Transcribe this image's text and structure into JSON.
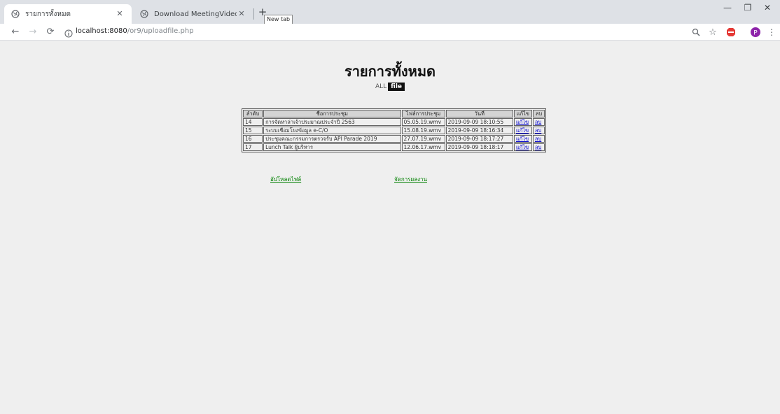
{
  "browser": {
    "tabs": [
      {
        "title": "รายการทั้งหมด",
        "active": true
      },
      {
        "title": "Download MeetingVideo",
        "active": false
      }
    ],
    "new_tab_tooltip": "New tab",
    "address": {
      "host": "localhost:8080",
      "path": "/or9/uploadfile.php"
    },
    "profile_initial": "P"
  },
  "page": {
    "title": "รายการทั้งหมด",
    "filter": {
      "all": "ALL",
      "file": "file"
    },
    "table": {
      "headers": [
        "ลำดับ",
        "ชื่อการประชุม",
        "ไฟล์การประชุม",
        "วันที่",
        "แก้ไข",
        "ลบ"
      ],
      "rows": [
        {
          "id": "14",
          "name": "การจัดหาล่าเจ้าประมาณประจำปี 2563",
          "file": "05.05.19.wmv",
          "date": "2019-09-09 18:10:55",
          "edit": "แก้ไข",
          "del": "ลบ"
        },
        {
          "id": "15",
          "name": "ระบบเชื่อมโยงข้อมูล e-C/O",
          "file": "15.08.19.wmv",
          "date": "2019-09-09 18:16:34",
          "edit": "แก้ไข",
          "del": "ลบ"
        },
        {
          "id": "16",
          "name": "ประชุมคณะกรรมการตรวจรับ API Parade 2019",
          "file": "27.07.19.wmv",
          "date": "2019-09-09 18:17:27",
          "edit": "แก้ไข",
          "del": "ลบ"
        },
        {
          "id": "17",
          "name": "Lunch Talk ผู้บริหาร",
          "file": "12.06.17.wmv",
          "date": "2019-09-09 18:18:17",
          "edit": "แก้ไข",
          "del": "ลบ"
        }
      ]
    },
    "links": {
      "upload": "อัปโหลดไฟล์",
      "manage": "จัดการผลงาน"
    }
  },
  "colors": {
    "link_green": "#008000",
    "page_bg": "#efefef",
    "chip_bg": "#111111"
  }
}
